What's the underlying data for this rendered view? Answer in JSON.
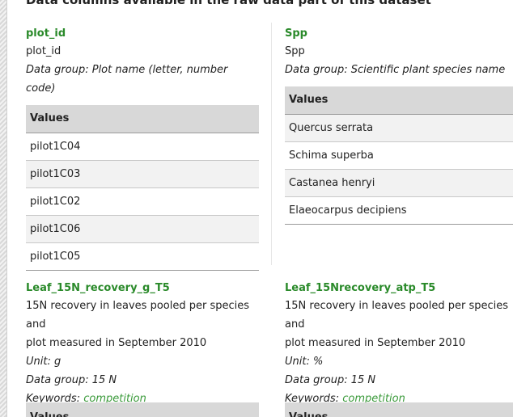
{
  "heading": "Data columns available in the raw data part of this dataset",
  "columns": [
    {
      "name": "plot_id",
      "description": "plot_id",
      "data_group_label": "Data group:",
      "data_group": "Plot name (letter, number code)",
      "values_header": "Values",
      "values": [
        "pilot1C04",
        "pilot1C03",
        "pilot1C02",
        "pilot1C06",
        "pilot1C05"
      ]
    },
    {
      "name": "Spp",
      "description": "Spp",
      "data_group_label": "Data group:",
      "data_group": "Scientific plant species name",
      "values_header": "Values",
      "values": [
        "Quercus serrata",
        "Schima superba",
        "Castanea henryi",
        "Elaeocarpus decipiens"
      ]
    },
    {
      "name": "Leaf_15N_recovery_g_T5",
      "description_line1": "15N recovery in leaves pooled per species and",
      "description_line2": "plot measured in September 2010",
      "unit_label": "Unit:",
      "unit": "g",
      "data_group_label": "Data group:",
      "data_group": "15 N",
      "keywords_label": "Keywords:",
      "keyword": "competition",
      "values_header": "Values"
    },
    {
      "name": "Leaf_15Nrecovery_atp_T5",
      "description_line1": "15N recovery in leaves pooled per species and",
      "description_line2": "plot measured in September 2010",
      "unit_label": "Unit:",
      "unit": "%",
      "data_group_label": "Data group:",
      "data_group": "15 N",
      "keywords_label": "Keywords:",
      "keyword": "competition",
      "values_header": "Values"
    }
  ]
}
